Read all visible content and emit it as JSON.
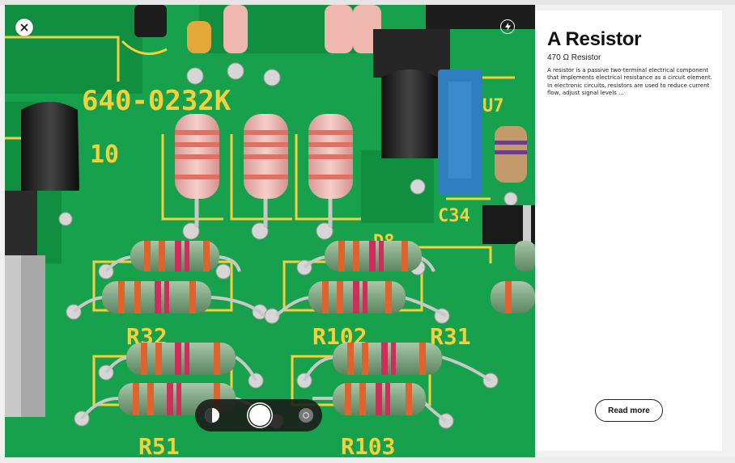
{
  "header": {
    "url_fragment": ""
  },
  "photo": {
    "board_labels": [
      "640-0232K",
      "10",
      "U7",
      "C34",
      "D8",
      "R32",
      "R102",
      "R31",
      "R51",
      "R103"
    ],
    "colors": {
      "board": "#16a04c",
      "silk": "#f2d13a",
      "pad": "#c9c9c9"
    }
  },
  "controls": {
    "close_icon": "close-icon",
    "flash_icon": "flash-icon",
    "camera_left_icon": "contrast-icon",
    "shutter_icon": "shutter-icon",
    "camera_right_icon": "switch-camera-icon"
  },
  "info": {
    "title": "A Resistor",
    "subtitle": "470 Ω  Resistor",
    "description": "A resistor is a passive two-terminal electrical component that implements electrical resistance as a circuit element. In electronic circuits, resistors are used to reduce current flow, adjust signal levels ...",
    "read_more_label": "Read more"
  }
}
